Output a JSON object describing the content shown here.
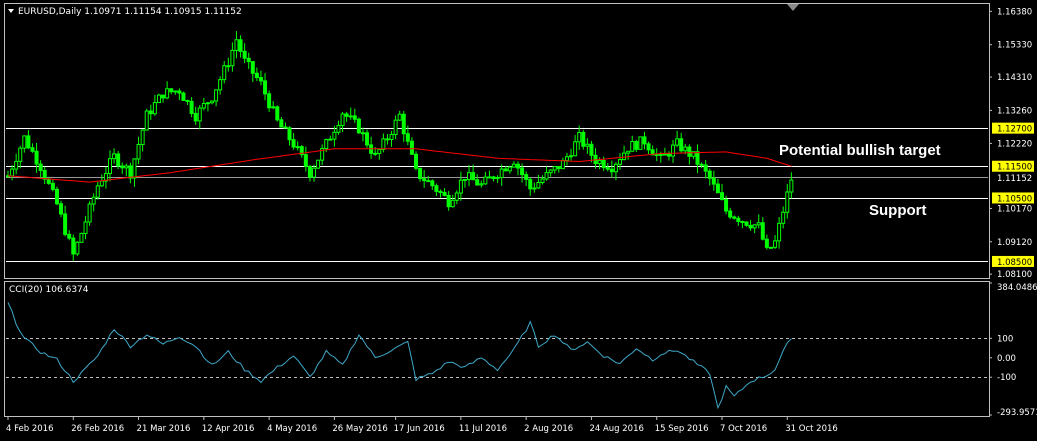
{
  "header": {
    "symbol_line": "EURUSD,Daily  1.10971 1.11154 1.10915 1.11152",
    "indicator_line": "CCI(20) 106.6374"
  },
  "annotations": {
    "target_text": "Potential bullish target",
    "support_text": "Support"
  },
  "colors": {
    "background": "#000000",
    "candle": "#00ff00",
    "ma": "#ff0000",
    "level_line": "#ffffff",
    "level_label_bg": "#ffff00",
    "cci": "#3fa9c9",
    "frame": "#c0c0c0"
  },
  "chart_data": [
    {
      "type": "candlestick",
      "title": "EURUSD,Daily",
      "ohlc_last": {
        "open": 1.10971,
        "high": 1.11154,
        "low": 1.10915,
        "close": 1.11152
      },
      "ylim": [
        1.0801,
        1.1658
      ],
      "y_ticks": [
        "1.16380",
        "1.15330",
        "1.14310",
        "1.13260",
        "1.12220",
        "1.11152",
        "1.10170",
        "1.09120",
        "1.08100"
      ],
      "levels": [
        {
          "value": 1.127,
          "label": "1.12700"
        },
        {
          "value": 1.115,
          "label": "1.11500"
        },
        {
          "value": 1.105,
          "label": "1.10500"
        },
        {
          "value": 1.085,
          "label": "1.08500"
        }
      ],
      "current_price": {
        "value": 1.11152,
        "label": "1.11152"
      },
      "x_labels": [
        "4 Feb 2016",
        "26 Feb 2016",
        "21 Mar 2016",
        "12 Apr 2016",
        "4 May 2016",
        "26 May 2016",
        "17 Jun 2016",
        "11 Jul 2016",
        "2 Aug 2016",
        "24 Aug 2016",
        "15 Sep 2016",
        "7 Oct 2016",
        "31 Oct 2016"
      ],
      "close_path": [
        [
          0,
          1.112
        ],
        [
          4,
          1.124
        ],
        [
          8,
          1.115
        ],
        [
          12,
          1.103
        ],
        [
          16,
          1.087
        ],
        [
          18,
          1.094
        ],
        [
          22,
          1.109
        ],
        [
          26,
          1.118
        ],
        [
          30,
          1.113
        ],
        [
          34,
          1.131
        ],
        [
          38,
          1.138
        ],
        [
          42,
          1.139
        ],
        [
          46,
          1.131
        ],
        [
          50,
          1.137
        ],
        [
          54,
          1.148
        ],
        [
          56,
          1.155
        ],
        [
          58,
          1.148
        ],
        [
          62,
          1.141
        ],
        [
          66,
          1.129
        ],
        [
          70,
          1.122
        ],
        [
          74,
          1.113
        ],
        [
          78,
          1.122
        ],
        [
          82,
          1.132
        ],
        [
          86,
          1.127
        ],
        [
          90,
          1.118
        ],
        [
          93,
          1.124
        ],
        [
          96,
          1.131
        ],
        [
          100,
          1.113
        ],
        [
          104,
          1.109
        ],
        [
          108,
          1.104
        ],
        [
          112,
          1.112
        ],
        [
          116,
          1.109
        ],
        [
          120,
          1.113
        ],
        [
          124,
          1.117
        ],
        [
          128,
          1.108
        ],
        [
          132,
          1.112
        ],
        [
          136,
          1.116
        ],
        [
          140,
          1.124
        ],
        [
          144,
          1.117
        ],
        [
          148,
          1.115
        ],
        [
          152,
          1.121
        ],
        [
          156,
          1.123
        ],
        [
          160,
          1.117
        ],
        [
          164,
          1.122
        ],
        [
          168,
          1.118
        ],
        [
          172,
          1.111
        ],
        [
          176,
          1.101
        ],
        [
          180,
          1.098
        ],
        [
          184,
          1.096
        ],
        [
          186,
          1.088
        ],
        [
          188,
          1.091
        ],
        [
          190,
          1.101
        ],
        [
          192,
          1.111
        ]
      ],
      "ma_path": [
        [
          0,
          1.112
        ],
        [
          20,
          1.11
        ],
        [
          40,
          1.113
        ],
        [
          60,
          1.117
        ],
        [
          80,
          1.1205
        ],
        [
          100,
          1.1205
        ],
        [
          120,
          1.1175
        ],
        [
          140,
          1.1165
        ],
        [
          160,
          1.119
        ],
        [
          176,
          1.1195
        ],
        [
          186,
          1.1175
        ],
        [
          192,
          1.115
        ]
      ]
    },
    {
      "type": "line",
      "title": "CCI(20) 106.6374",
      "ylim": [
        -293.9571,
        384.0486
      ],
      "y_ticks": [
        "384.0486",
        "100",
        "0.00",
        "-100",
        "-293.9571"
      ],
      "levels": [
        100,
        -100
      ],
      "x_domain": [
        0,
        192
      ],
      "values_path": [
        [
          0,
          280
        ],
        [
          2,
          180
        ],
        [
          4,
          100
        ],
        [
          8,
          30
        ],
        [
          12,
          -10
        ],
        [
          16,
          -120
        ],
        [
          18,
          -80
        ],
        [
          22,
          10
        ],
        [
          26,
          150
        ],
        [
          30,
          60
        ],
        [
          34,
          120
        ],
        [
          38,
          70
        ],
        [
          42,
          110
        ],
        [
          46,
          60
        ],
        [
          50,
          -40
        ],
        [
          54,
          30
        ],
        [
          58,
          -60
        ],
        [
          62,
          -120
        ],
        [
          66,
          -50
        ],
        [
          70,
          10
        ],
        [
          74,
          -100
        ],
        [
          78,
          30
        ],
        [
          82,
          -40
        ],
        [
          86,
          120
        ],
        [
          90,
          0
        ],
        [
          94,
          40
        ],
        [
          98,
          80
        ],
        [
          100,
          -110
        ],
        [
          104,
          -80
        ],
        [
          108,
          -20
        ],
        [
          112,
          -50
        ],
        [
          116,
          0
        ],
        [
          120,
          -60
        ],
        [
          124,
          40
        ],
        [
          128,
          180
        ],
        [
          130,
          60
        ],
        [
          134,
          120
        ],
        [
          138,
          40
        ],
        [
          142,
          80
        ],
        [
          146,
          10
        ],
        [
          150,
          -30
        ],
        [
          154,
          50
        ],
        [
          158,
          -10
        ],
        [
          160,
          20
        ],
        [
          164,
          40
        ],
        [
          168,
          -20
        ],
        [
          172,
          -80
        ],
        [
          174,
          -260
        ],
        [
          176,
          -150
        ],
        [
          178,
          -200
        ],
        [
          182,
          -120
        ],
        [
          186,
          -90
        ],
        [
          188,
          -60
        ],
        [
          190,
          30
        ],
        [
          192,
          106.6
        ]
      ]
    }
  ]
}
